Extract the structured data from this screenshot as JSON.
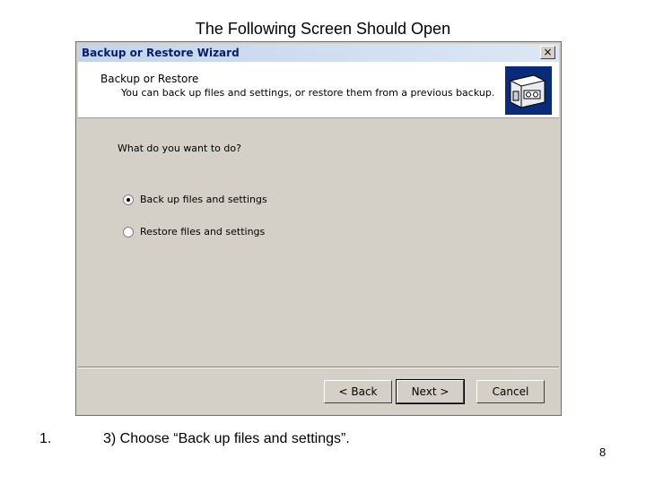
{
  "slide": {
    "title": "The Following Screen Should Open",
    "step_number": "1.",
    "instruction": "3) Choose “Back up files and settings”.",
    "page_number": "8"
  },
  "window": {
    "title": "Backup or Restore Wizard",
    "close_glyph": "×",
    "header_title": "Backup or Restore",
    "header_subtitle": "You can back up files and settings, or restore them from a previous backup.",
    "header_icon": "backup-tape-icon",
    "question": "What do you want to do?",
    "options": [
      {
        "label": "Back up files and settings",
        "selected": true
      },
      {
        "label": "Restore files and settings",
        "selected": false
      }
    ],
    "buttons": {
      "back": "< Back",
      "next": "Next >",
      "cancel": "Cancel"
    }
  }
}
